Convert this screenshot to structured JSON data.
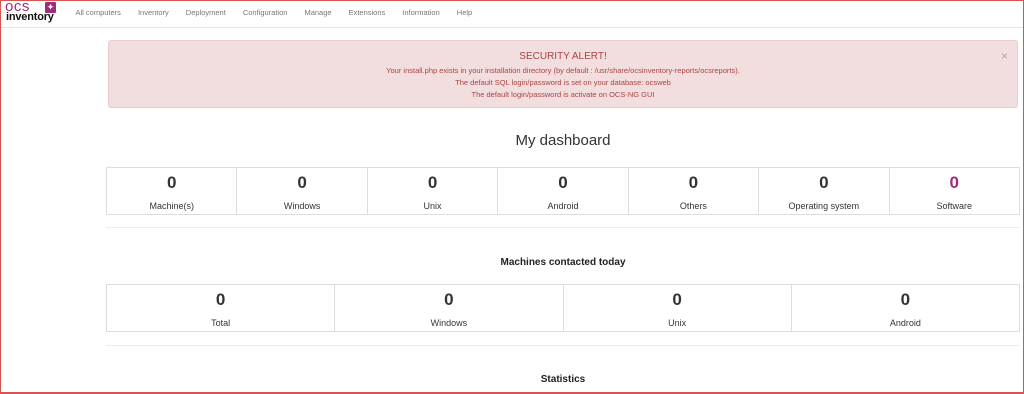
{
  "brand": {
    "logo_top": "ocs",
    "logo_bottom": "inventory",
    "color": "#a12c7b"
  },
  "nav": {
    "items": [
      "All computers",
      "Inventory",
      "Deployment",
      "Configuration",
      "Manage",
      "Extensions",
      "Information",
      "Help"
    ]
  },
  "alert": {
    "title": "SECURITY ALERT!",
    "lines": [
      "Your install.php exists in your installation directory (by default : /usr/share/ocsinventory-reports/ocsreports).",
      "The default SQL login/password is set on your database: ocsweb",
      "The default login/password is activate on OCS-NG GUI"
    ],
    "close": "×",
    "colors": {
      "bg": "#f2dede",
      "text": "#a94442"
    }
  },
  "dashboard": {
    "title": "My dashboard",
    "stats": [
      {
        "value": "0",
        "label": "Machine(s)"
      },
      {
        "value": "0",
        "label": "Windows"
      },
      {
        "value": "0",
        "label": "Unix"
      },
      {
        "value": "0",
        "label": "Android"
      },
      {
        "value": "0",
        "label": "Others"
      },
      {
        "value": "0",
        "label": "Operating system"
      },
      {
        "value": "0",
        "label": "Software"
      }
    ]
  },
  "contacted": {
    "title": "Machines contacted today",
    "stats": [
      {
        "value": "0",
        "label": "Total"
      },
      {
        "value": "0",
        "label": "Windows"
      },
      {
        "value": "0",
        "label": "Unix"
      },
      {
        "value": "0",
        "label": "Android"
      }
    ]
  },
  "statistics": {
    "title": "Statistics"
  }
}
